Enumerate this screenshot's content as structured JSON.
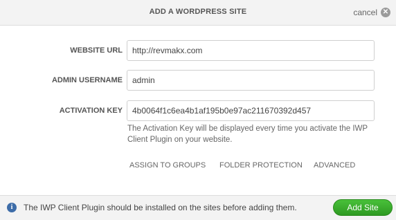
{
  "dialog": {
    "title": "ADD A WORDPRESS SITE",
    "cancel_label": "cancel",
    "cancel_icon": "close-circle-icon"
  },
  "form": {
    "website_url": {
      "label": "WEBSITE URL",
      "value": "http://revmakx.com"
    },
    "admin_username": {
      "label": "ADMIN USERNAME",
      "value": "admin"
    },
    "activation_key": {
      "label": "ACTIVATION KEY",
      "value": "4b0064f1c6ea4b1af195b0e97ac211670392d457",
      "hint": "The Activation Key will be displayed every time you activate the IWP Client Plugin on your website."
    }
  },
  "options": {
    "assign_groups": "ASSIGN TO GROUPS",
    "folder_protection": "FOLDER PROTECTION",
    "advanced": "ADVANCED"
  },
  "footer": {
    "info_icon": "info-icon",
    "info_glyph": "i",
    "note": "The IWP Client Plugin should be installed on the sites before adding them.",
    "add_button_label": "Add Site",
    "accent_color": "#3aab2c"
  }
}
